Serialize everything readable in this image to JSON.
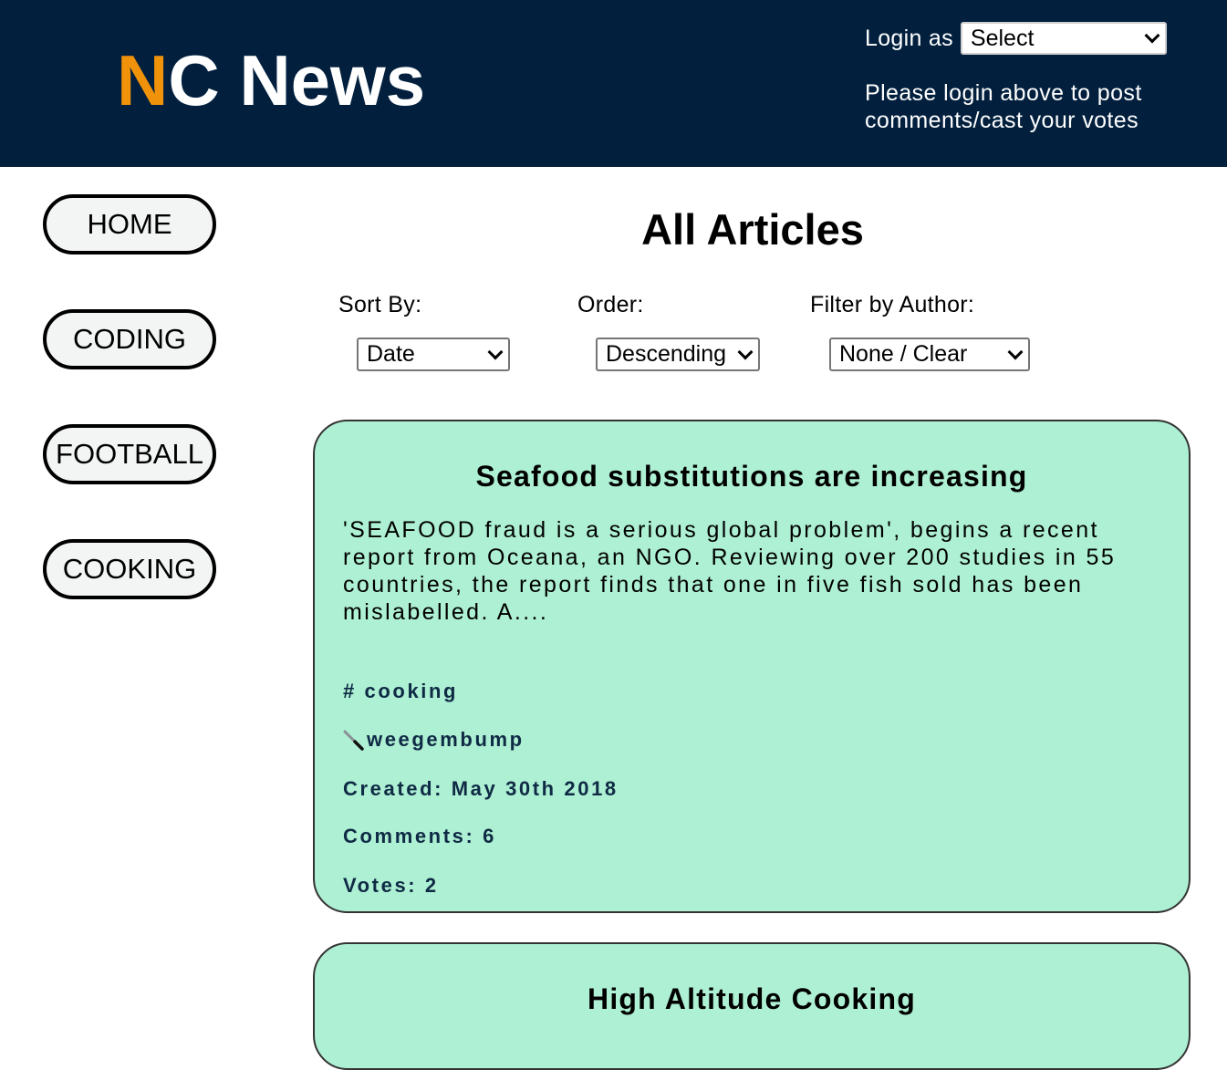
{
  "header": {
    "logo_n": "N",
    "logo_rest": "C News",
    "login_label": "Login as",
    "login_select": "Select",
    "login_message": "Please login above to post comments/cast your votes"
  },
  "nav": {
    "items": [
      {
        "label": "HOME"
      },
      {
        "label": "CODING"
      },
      {
        "label": "FOOTBALL"
      },
      {
        "label": "COOKING"
      }
    ]
  },
  "main": {
    "title": "All Articles",
    "sort_label": "Sort By:",
    "sort_value": "Date",
    "order_label": "Order:",
    "order_value": "Descending",
    "filter_label": "Filter by Author:",
    "filter_value": "None / Clear"
  },
  "articles": [
    {
      "title": "Seafood substitutions are increasing",
      "body": "'SEAFOOD fraud is a serious global problem', begins a recent report from Oceana, an NGO. Reviewing over 200 studies in 55 countries, the report finds that one in five fish sold has been mislabelled. A....",
      "topic": "# cooking",
      "author": "weegembump",
      "created": "Created: May 30th 2018",
      "comments": "Comments: 6",
      "votes": "Votes: 2"
    },
    {
      "title": "High Altitude Cooking"
    }
  ],
  "colors": {
    "header_bg": "#02203e",
    "logo_accent": "#f0930a",
    "card_bg": "#aef0d3"
  }
}
